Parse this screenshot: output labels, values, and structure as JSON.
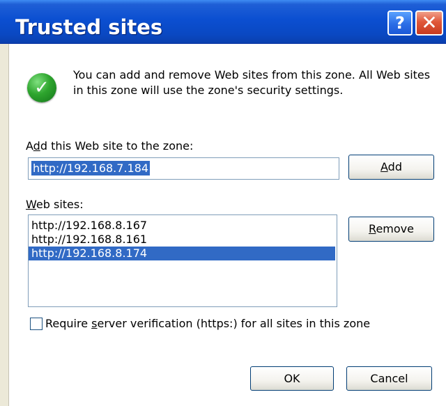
{
  "window": {
    "title": "Trusted sites",
    "help_glyph": "?",
    "close_glyph": "✕"
  },
  "info": {
    "icon": "check-shield-icon",
    "text": "You can add and remove Web sites from this zone. All Web sites in this zone will use the zone's security settings."
  },
  "add_site": {
    "label_pre": "A",
    "label_accel": "d",
    "label_post": "d this Web site to the zone:",
    "value": "http://192.168.7.184",
    "button_pre": "",
    "button_accel": "A",
    "button_post": "dd"
  },
  "web_sites": {
    "label_pre": "",
    "label_accel": "W",
    "label_post": "eb sites:",
    "items": [
      "http://192.168.8.167",
      "http://192.168.8.161",
      "http://192.168.8.174"
    ],
    "selected_index": 2,
    "remove_pre": "",
    "remove_accel": "R",
    "remove_post": "emove"
  },
  "verification": {
    "checked": false,
    "label_pre": "Require ",
    "label_accel": "s",
    "label_post": "erver verification (https:) for all sites in this zone"
  },
  "footer": {
    "ok_label": "OK",
    "cancel_label": "Cancel"
  },
  "colors": {
    "titlebar": "#0a48c2",
    "selection": "#316ac5",
    "check": "#2ea52e",
    "close": "#e0583a"
  }
}
